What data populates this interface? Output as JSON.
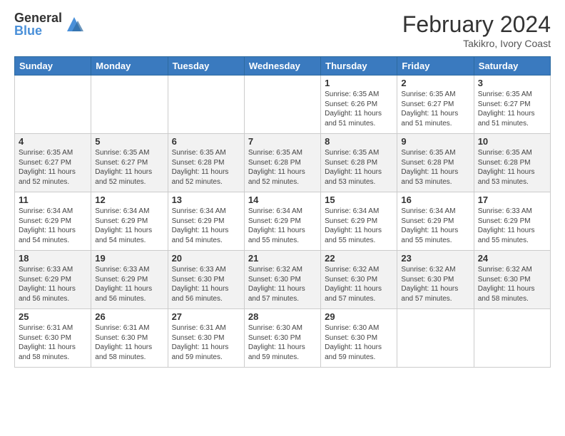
{
  "header": {
    "logo_general": "General",
    "logo_blue": "Blue",
    "month_title": "February 2024",
    "subtitle": "Takikro, Ivory Coast"
  },
  "days_of_week": [
    "Sunday",
    "Monday",
    "Tuesday",
    "Wednesday",
    "Thursday",
    "Friday",
    "Saturday"
  ],
  "weeks": [
    [
      {
        "day": "",
        "info": ""
      },
      {
        "day": "",
        "info": ""
      },
      {
        "day": "",
        "info": ""
      },
      {
        "day": "",
        "info": ""
      },
      {
        "day": "1",
        "info": "Sunrise: 6:35 AM\nSunset: 6:26 PM\nDaylight: 11 hours\nand 51 minutes."
      },
      {
        "day": "2",
        "info": "Sunrise: 6:35 AM\nSunset: 6:27 PM\nDaylight: 11 hours\nand 51 minutes."
      },
      {
        "day": "3",
        "info": "Sunrise: 6:35 AM\nSunset: 6:27 PM\nDaylight: 11 hours\nand 51 minutes."
      }
    ],
    [
      {
        "day": "4",
        "info": "Sunrise: 6:35 AM\nSunset: 6:27 PM\nDaylight: 11 hours\nand 52 minutes."
      },
      {
        "day": "5",
        "info": "Sunrise: 6:35 AM\nSunset: 6:27 PM\nDaylight: 11 hours\nand 52 minutes."
      },
      {
        "day": "6",
        "info": "Sunrise: 6:35 AM\nSunset: 6:28 PM\nDaylight: 11 hours\nand 52 minutes."
      },
      {
        "day": "7",
        "info": "Sunrise: 6:35 AM\nSunset: 6:28 PM\nDaylight: 11 hours\nand 52 minutes."
      },
      {
        "day": "8",
        "info": "Sunrise: 6:35 AM\nSunset: 6:28 PM\nDaylight: 11 hours\nand 53 minutes."
      },
      {
        "day": "9",
        "info": "Sunrise: 6:35 AM\nSunset: 6:28 PM\nDaylight: 11 hours\nand 53 minutes."
      },
      {
        "day": "10",
        "info": "Sunrise: 6:35 AM\nSunset: 6:28 PM\nDaylight: 11 hours\nand 53 minutes."
      }
    ],
    [
      {
        "day": "11",
        "info": "Sunrise: 6:34 AM\nSunset: 6:29 PM\nDaylight: 11 hours\nand 54 minutes."
      },
      {
        "day": "12",
        "info": "Sunrise: 6:34 AM\nSunset: 6:29 PM\nDaylight: 11 hours\nand 54 minutes."
      },
      {
        "day": "13",
        "info": "Sunrise: 6:34 AM\nSunset: 6:29 PM\nDaylight: 11 hours\nand 54 minutes."
      },
      {
        "day": "14",
        "info": "Sunrise: 6:34 AM\nSunset: 6:29 PM\nDaylight: 11 hours\nand 55 minutes."
      },
      {
        "day": "15",
        "info": "Sunrise: 6:34 AM\nSunset: 6:29 PM\nDaylight: 11 hours\nand 55 minutes."
      },
      {
        "day": "16",
        "info": "Sunrise: 6:34 AM\nSunset: 6:29 PM\nDaylight: 11 hours\nand 55 minutes."
      },
      {
        "day": "17",
        "info": "Sunrise: 6:33 AM\nSunset: 6:29 PM\nDaylight: 11 hours\nand 55 minutes."
      }
    ],
    [
      {
        "day": "18",
        "info": "Sunrise: 6:33 AM\nSunset: 6:29 PM\nDaylight: 11 hours\nand 56 minutes."
      },
      {
        "day": "19",
        "info": "Sunrise: 6:33 AM\nSunset: 6:29 PM\nDaylight: 11 hours\nand 56 minutes."
      },
      {
        "day": "20",
        "info": "Sunrise: 6:33 AM\nSunset: 6:30 PM\nDaylight: 11 hours\nand 56 minutes."
      },
      {
        "day": "21",
        "info": "Sunrise: 6:32 AM\nSunset: 6:30 PM\nDaylight: 11 hours\nand 57 minutes."
      },
      {
        "day": "22",
        "info": "Sunrise: 6:32 AM\nSunset: 6:30 PM\nDaylight: 11 hours\nand 57 minutes."
      },
      {
        "day": "23",
        "info": "Sunrise: 6:32 AM\nSunset: 6:30 PM\nDaylight: 11 hours\nand 57 minutes."
      },
      {
        "day": "24",
        "info": "Sunrise: 6:32 AM\nSunset: 6:30 PM\nDaylight: 11 hours\nand 58 minutes."
      }
    ],
    [
      {
        "day": "25",
        "info": "Sunrise: 6:31 AM\nSunset: 6:30 PM\nDaylight: 11 hours\nand 58 minutes."
      },
      {
        "day": "26",
        "info": "Sunrise: 6:31 AM\nSunset: 6:30 PM\nDaylight: 11 hours\nand 58 minutes."
      },
      {
        "day": "27",
        "info": "Sunrise: 6:31 AM\nSunset: 6:30 PM\nDaylight: 11 hours\nand 59 minutes."
      },
      {
        "day": "28",
        "info": "Sunrise: 6:30 AM\nSunset: 6:30 PM\nDaylight: 11 hours\nand 59 minutes."
      },
      {
        "day": "29",
        "info": "Sunrise: 6:30 AM\nSunset: 6:30 PM\nDaylight: 11 hours\nand 59 minutes."
      },
      {
        "day": "",
        "info": ""
      },
      {
        "day": "",
        "info": ""
      }
    ]
  ]
}
